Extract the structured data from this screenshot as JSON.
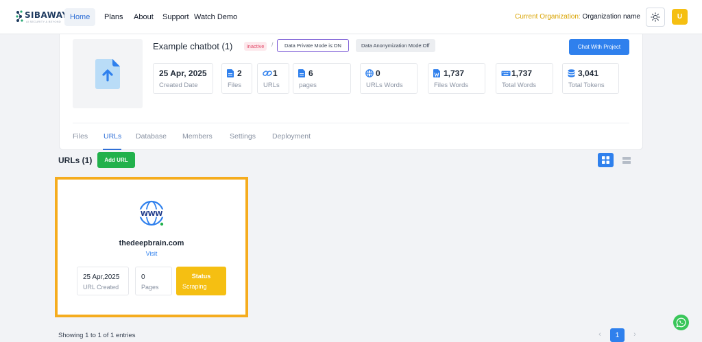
{
  "brand": {
    "name": "SIBAWAY",
    "tagline": "AI SECURITY & BEYOND"
  },
  "nav": {
    "items": [
      {
        "label": "Home",
        "active": true
      },
      {
        "label": "Plans"
      },
      {
        "label": "About"
      },
      {
        "label": "Support"
      },
      {
        "label": "Watch Demo"
      }
    ]
  },
  "org": {
    "label": "Current Organization:",
    "name": "Organization name"
  },
  "user": {
    "initial": "U"
  },
  "project": {
    "title": "Example chatbot (1)",
    "status": "inactive",
    "separator": "/",
    "private_mode": "Data Private Mode is:ON",
    "anonymization": "Data Anonymization Mode:Off",
    "chat_button": "Chat With Project",
    "stats": [
      {
        "value": "25 Apr, 2025",
        "label": "Created Date",
        "icon": ""
      },
      {
        "value": "2",
        "label": "Files",
        "icon": "file-icon"
      },
      {
        "value": "1",
        "label": "URLs",
        "icon": "link-icon"
      },
      {
        "value": "6",
        "label": "pages",
        "icon": "file-icon"
      },
      {
        "value": "0",
        "label": "URLs Words",
        "icon": "globe-icon"
      },
      {
        "value": "1,737",
        "label": "Files Words",
        "icon": "word-file-icon"
      },
      {
        "value": "1,737",
        "label": "Total Words",
        "icon": "keyboard-icon"
      },
      {
        "value": "3,041",
        "label": "Total Tokens",
        "icon": "database-icon"
      }
    ],
    "tabs": [
      {
        "label": "Files"
      },
      {
        "label": "URLs",
        "active": true
      },
      {
        "label": "Database"
      },
      {
        "label": "Members"
      },
      {
        "label": "Settings"
      },
      {
        "label": "Deployment"
      }
    ]
  },
  "urls": {
    "title": "URLs (1)",
    "add_button": "Add URL",
    "items": [
      {
        "domain": "thedeepbrain.com",
        "visit": "Visit",
        "date_value": "25 Apr,2025",
        "date_label": "URL Created",
        "pages_value": "0",
        "pages_label": "Pages",
        "status_label": "Status",
        "status_value": "Scraping"
      }
    ]
  },
  "footer": {
    "entries": "Showing 1 to 1 of 1 entries",
    "pagination": {
      "prev": "‹",
      "current": "1",
      "next": "›"
    }
  },
  "colors": {
    "accent": "#2f80ed",
    "success": "#22b14c",
    "warning": "#f5bf12",
    "highlight": "#f5ac1e"
  }
}
